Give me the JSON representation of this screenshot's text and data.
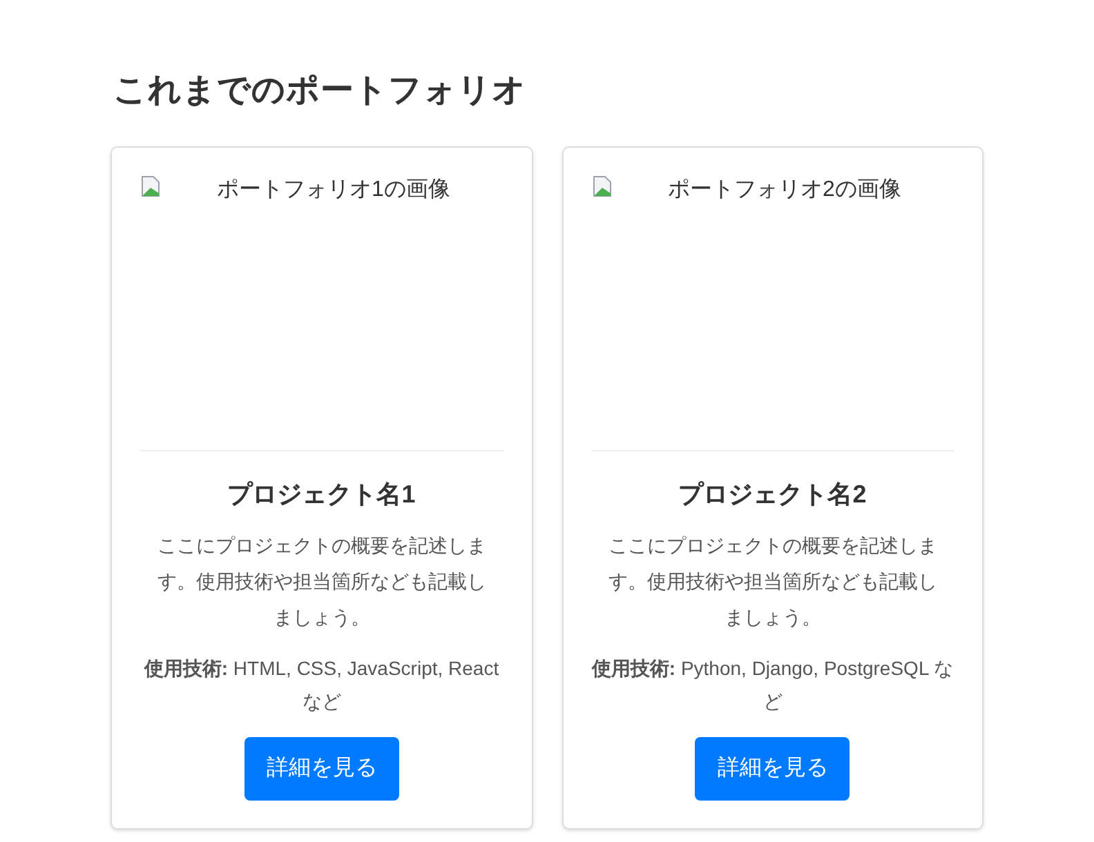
{
  "heading": "これまでのポートフォリオ",
  "cards": [
    {
      "image": {
        "kind": "picture",
        "alt": "ポートフォリオ1の画像"
      },
      "title": "プロジェクト名1",
      "description": "ここにプロジェクトの概要を記述します。使用技術や担当箇所なども記載しましょう。",
      "tech": "**使用技術:** HTML, CSS, JavaScript, React など",
      "button": "詳細を見る"
    },
    {
      "image": {
        "kind": "picture",
        "alt": "ポートフォリオ2の画像"
      },
      "title": "プロジェクト名2",
      "description": "ここにプロジェクトの概要を記述します。使用技術や担当箇所なども記載しましょう。",
      "tech": "**使用技術:** Python, Django, PostgreSQL など",
      "button": "詳細を見る"
    }
  ]
}
